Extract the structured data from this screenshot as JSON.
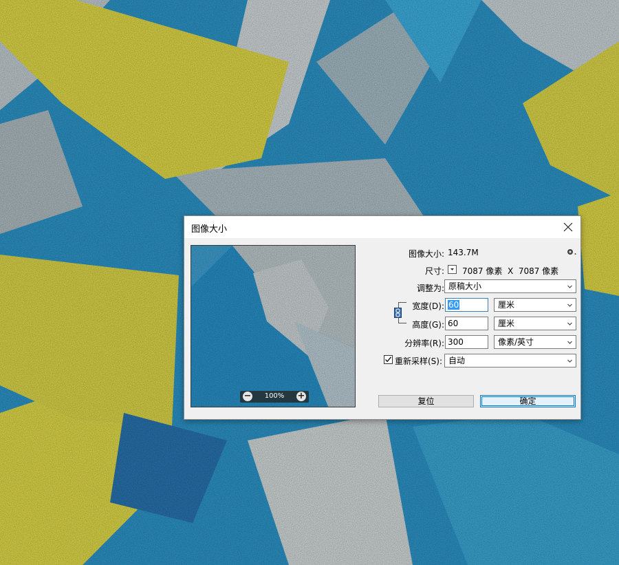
{
  "dialog": {
    "title": "图像大小",
    "image_size_label": "图像大小:",
    "image_size_value": "143.7M",
    "dimensions_label": "尺寸:",
    "dimensions_value": "7087 像素  X  7087 像素",
    "fit_to_label": "调整为:",
    "fit_to_value": "原稿大小",
    "width_label": "宽度(D):",
    "width_value": "60",
    "width_unit": "厘米",
    "height_label": "高度(G):",
    "height_value": "60",
    "height_unit": "厘米",
    "resolution_label": "分辨率(R):",
    "resolution_value": "300",
    "resolution_unit": "像素/英寸",
    "resample_label": "重新采样(S):",
    "resample_value": "自动",
    "resample_checked": true,
    "preview_zoom": "100%",
    "reset_button": "复位",
    "ok_button": "确定"
  },
  "icons": {
    "close": "close-icon",
    "settings": "gear-icon",
    "zoom_out": "zoom-out-icon",
    "zoom_in": "zoom-in-icon",
    "link": "chain-link-icon"
  },
  "colors": {
    "canvas_blue": "#2f8fc0",
    "canvas_yellow": "#d8d24a",
    "canvas_gray": "#b9c3c7",
    "accent": "#0078d7"
  }
}
